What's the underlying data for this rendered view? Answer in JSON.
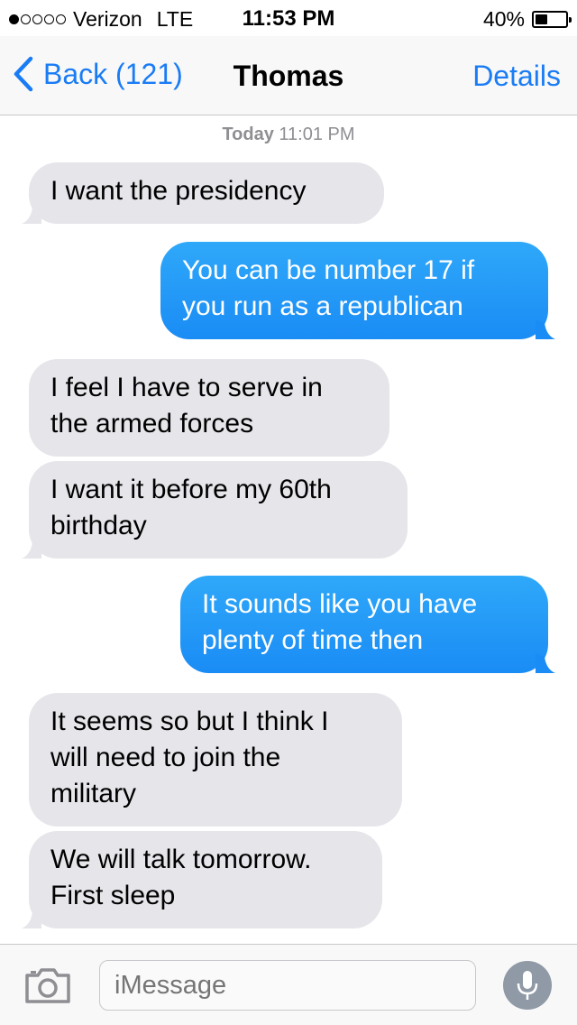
{
  "status_bar": {
    "carrier": "Verizon",
    "network": "LTE",
    "time": "11:53 PM",
    "battery_percent": "40%",
    "battery_level": 0.4,
    "signal_bars_filled": 1,
    "signal_bars_total": 5
  },
  "nav": {
    "back_label": "Back (121)",
    "title": "Thomas",
    "details_label": "Details"
  },
  "thread": {
    "timestamp_day": "Today",
    "timestamp_time": "11:01 PM",
    "messages": [
      {
        "direction": "in",
        "lines": [
          "I want the presidency"
        ]
      },
      {
        "direction": "out",
        "lines": [
          "You can be number 17 if",
          "you run as a republican"
        ]
      },
      {
        "direction": "in",
        "lines": [
          "I feel I have to serve in",
          "the armed forces"
        ]
      },
      {
        "direction": "in",
        "lines": [
          "I want it before my 60th",
          "birthday"
        ]
      },
      {
        "direction": "out",
        "lines": [
          "It sounds like you have",
          "plenty of time then"
        ]
      },
      {
        "direction": "in",
        "lines": [
          "It seems so but I think I",
          "will need to join the",
          "military"
        ]
      },
      {
        "direction": "in",
        "lines": [
          "We will talk tomorrow.",
          "First sleep"
        ]
      }
    ]
  },
  "input_bar": {
    "placeholder": "iMessage",
    "camera_icon": "camera-icon",
    "mic_icon": "microphone-icon"
  },
  "colors": {
    "accent": "#1a7cf5",
    "incoming_bubble": "#e5e5ea",
    "outgoing_bubble": "#1a8cf5",
    "timestamp": "#8e8e93"
  }
}
